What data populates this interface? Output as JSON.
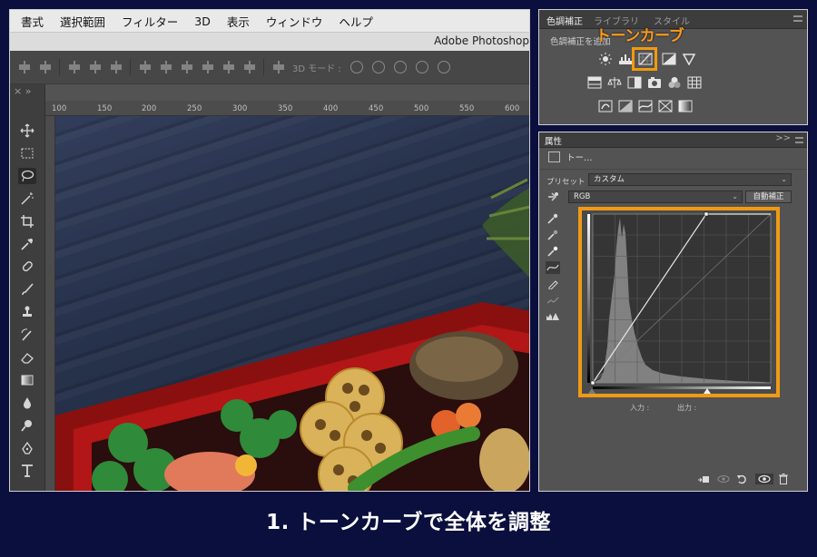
{
  "menubar": {
    "items": [
      "書式",
      "選択範囲",
      "フィルター",
      "3D",
      "表示",
      "ウィンドウ",
      "ヘルプ"
    ]
  },
  "window": {
    "title": "Adobe Photoshop"
  },
  "optionsbar": {
    "mode_label": "3D モード :"
  },
  "toolbar": {
    "header": "×  »"
  },
  "ruler": {
    "ticks": [
      "100",
      "150",
      "200",
      "250",
      "300",
      "350",
      "400",
      "450",
      "500",
      "550",
      "600"
    ]
  },
  "adjustments_panel": {
    "tabs": [
      "色調補正",
      "ライブラリ",
      "スタイル"
    ],
    "subtitle": "色調補正を追加",
    "callout": "トーンカーブ",
    "icons": [
      "brightness-icon",
      "levels-icon",
      "curves-icon",
      "exposure-icon",
      "vibrance-icon",
      "hue-saturation-icon",
      "color-balance-icon",
      "black-white-icon",
      "photo-filter-icon",
      "channel-mixer-icon",
      "color-lookup-icon",
      "invert-icon",
      "posterize-icon",
      "threshold-icon",
      "selective-color-icon",
      "gradient-map-icon"
    ]
  },
  "properties_panel": {
    "tab": "属性",
    "collapse": ">>",
    "title": "トー…",
    "preset_label": "プリセット :",
    "preset_value": "カスタム",
    "channel_value": "RGB",
    "auto_button": "自動補正",
    "input_label": "入力 :",
    "output_label": "出力 :",
    "tools": [
      "target-adjust-icon",
      "black-eyedropper-icon",
      "gray-eyedropper-icon",
      "white-eyedropper-icon",
      "curve-point-icon",
      "pencil-icon",
      "smooth-icon",
      "clipping-warning-icon"
    ]
  },
  "caption": "1. トーンカーブで全体を調整",
  "colors": {
    "highlight": "#f29a0d",
    "background": "#0b0f3d",
    "panel": "#535353"
  }
}
